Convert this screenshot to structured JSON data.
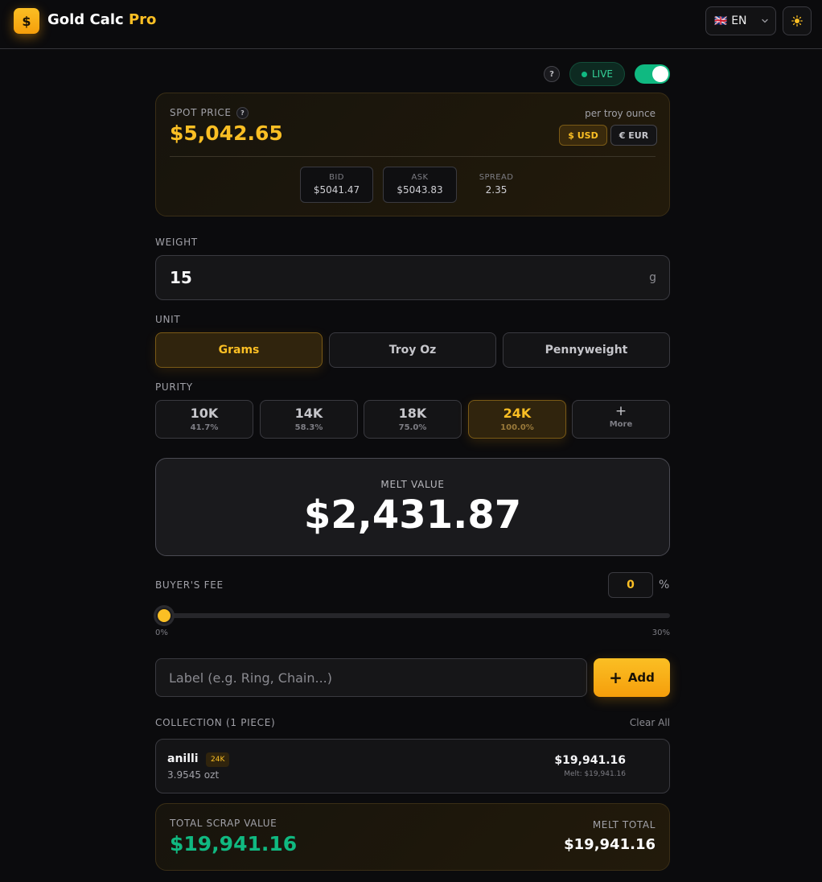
{
  "header": {
    "logo_symbol": "$",
    "brand_main": "Gold Calc",
    "brand_accent": "Pro",
    "language": {
      "flag": "🇬🇧",
      "code": "EN"
    },
    "theme_icon": "sun-icon"
  },
  "live": {
    "help": "?",
    "status": "LIVE",
    "toggle_on": true
  },
  "spot": {
    "label": "SPOT PRICE",
    "help": "?",
    "price": "$5,042.65",
    "per_unit": "per troy ounce",
    "currencies": [
      {
        "label": "$ USD",
        "active": true
      },
      {
        "label": "€ EUR",
        "active": false
      }
    ],
    "bid": {
      "label": "BID",
      "value": "$5041.47"
    },
    "ask": {
      "label": "ASK",
      "value": "$5043.83"
    },
    "spread": {
      "label": "SPREAD",
      "value": "2.35"
    }
  },
  "weight": {
    "label": "WEIGHT",
    "value": "15",
    "unit": "g"
  },
  "unit": {
    "label": "UNIT",
    "options": [
      "Grams",
      "Troy Oz",
      "Pennyweight"
    ],
    "selected": "Grams"
  },
  "purity": {
    "label": "PURITY",
    "options": [
      {
        "karat": "10K",
        "pct": "41.7%"
      },
      {
        "karat": "14K",
        "pct": "58.3%"
      },
      {
        "karat": "18K",
        "pct": "75.0%"
      },
      {
        "karat": "24K",
        "pct": "100.0%"
      }
    ],
    "selected": "24K",
    "more_symbol": "+",
    "more_label": "More"
  },
  "melt": {
    "label": "MELT VALUE",
    "value": "$2,431.87"
  },
  "fee": {
    "label": "BUYER'S FEE",
    "value": "0",
    "unit": "%",
    "min_label": "0%",
    "max_label": "30%",
    "level_percent": 0
  },
  "add_item": {
    "placeholder": "Label (e.g. Ring, Chain...)",
    "button_symbol": "+",
    "button_label": "Add"
  },
  "collection": {
    "label": "COLLECTION (1 PIECE)",
    "clear_label": "Clear All",
    "items": [
      {
        "name": "anilli",
        "karat": "24K",
        "weight": "3.9545 ozt",
        "value": "$19,941.16",
        "melt": "Melt: $19,941.16"
      }
    ]
  },
  "total": {
    "label": "TOTAL SCRAP VALUE",
    "value": "$19,941.16",
    "melt_label": "MELT TOTAL",
    "melt_value": "$19,941.16"
  },
  "colors": {
    "accent": "#fbbf24",
    "live_green": "#10b981",
    "background": "#0b0b0d"
  }
}
